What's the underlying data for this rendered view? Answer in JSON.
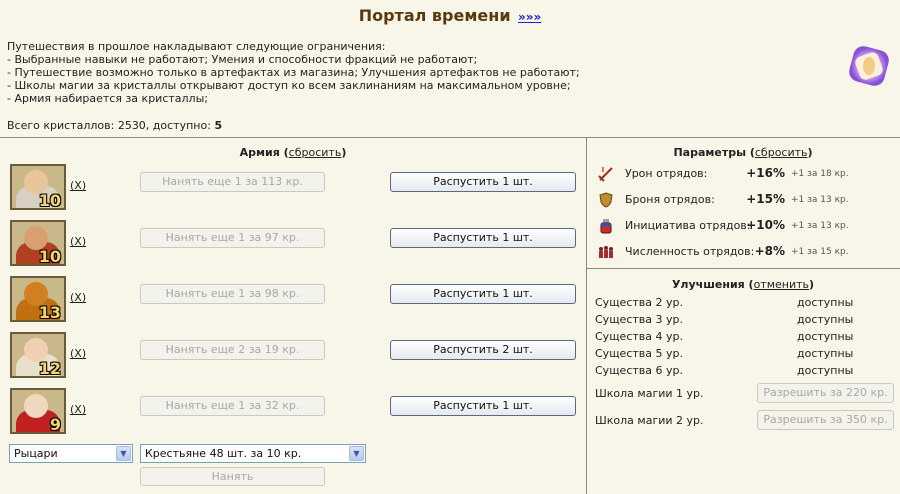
{
  "header": {
    "title": "Портал времени",
    "more_link": "»»»"
  },
  "intro": {
    "lines": [
      "Путешествия в прошлое накладывают следующие ограничения:",
      "- Выбранные навыки не работают; Умения и способности фракций не работают;",
      "- Путешествие возможно только в артефактах из магазина; Улучшения артефактов не работают;",
      "- Школы магии за кристаллы открывают доступ ко всем заклинаниям на максимальном уровне;",
      "- Армия набирается за кристаллы;"
    ],
    "crystals_text": "Всего кристаллов: 2530, доступно:",
    "crystals_available": "5"
  },
  "army": {
    "title": "Армия",
    "reset_label": "сбросить",
    "units": [
      {
        "count": "10",
        "remove": "(X)",
        "hire_label": "Нанять еще 1 за 113 кр.",
        "dismiss_label": "Распустить 1 шт.",
        "color_head": "#e8c49a",
        "color_body": "#d8d0c0"
      },
      {
        "count": "10",
        "remove": "(X)",
        "hire_label": "Нанять еще 1 за 97 кр.",
        "dismiss_label": "Распустить 1 шт.",
        "color_head": "#d8a070",
        "color_body": "#b04020"
      },
      {
        "count": "13",
        "remove": "(X)",
        "hire_label": "Нанять еще 1 за 98 кр.",
        "dismiss_label": "Распустить 1 шт.",
        "color_head": "#d08020",
        "color_body": "#c07010"
      },
      {
        "count": "12",
        "remove": "(X)",
        "hire_label": "Нанять еще 2 за 19 кр.",
        "dismiss_label": "Распустить 2 шт.",
        "color_head": "#f0d0b0",
        "color_body": "#e8e0c8"
      },
      {
        "count": "9",
        "remove": "(X)",
        "hire_label": "Нанять еще 1 за 32 кр.",
        "dismiss_label": "Распустить 1 шт.",
        "color_head": "#f0d8c0",
        "color_body": "#c02020"
      }
    ],
    "faction_select": "Рыцари",
    "unit_select": "Крестьяне 48 шт. за 10 кр.",
    "hire_button": "Нанять"
  },
  "params": {
    "title": "Параметры",
    "reset_label": "сбросить",
    "items": [
      {
        "label": "Урон отрядов:",
        "value": "+16%",
        "extra": "+1 за 18 кр.",
        "icon": "sword-icon"
      },
      {
        "label": "Броня отрядов:",
        "value": "+15%",
        "extra": "+1 за 13 кр.",
        "icon": "shield-icon"
      },
      {
        "label": "Инициатива отрядов:",
        "value": "+10%",
        "extra": "+1 за 13 кр.",
        "icon": "potion-icon"
      },
      {
        "label": "Численность отрядов:",
        "value": "+8%",
        "extra": "+1 за 15 кр.",
        "icon": "troops-icon"
      }
    ]
  },
  "upgrades": {
    "title": "Улучшения",
    "cancel_label": "отменить",
    "items": [
      {
        "label": "Существа 2 ур.",
        "status": "доступны"
      },
      {
        "label": "Существа 3 ур.",
        "status": "доступны"
      },
      {
        "label": "Существа 4 ур.",
        "status": "доступны"
      },
      {
        "label": "Существа 5 ур.",
        "status": "доступны"
      },
      {
        "label": "Существа 6 ур.",
        "status": "доступны"
      }
    ],
    "schools": [
      {
        "label": "Школа магии 1 ур.",
        "button": "Разрешить за 220 кр."
      },
      {
        "label": "Школа магии 2 ур.",
        "button": "Разрешить за 350 кр."
      }
    ]
  },
  "colors": {
    "title": "#5a3910",
    "link": "#1c1cc8",
    "background": "#f8f5e9",
    "divider": "#8a8a80"
  }
}
